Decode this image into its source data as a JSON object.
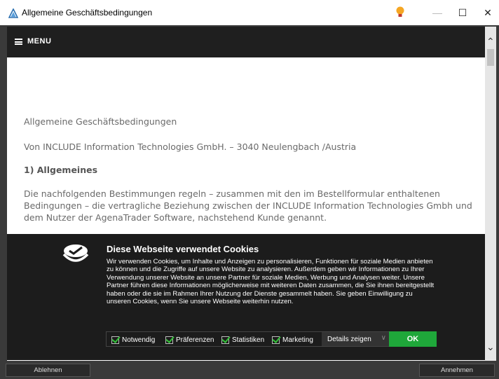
{
  "window": {
    "title": "Allgemeine Geschäftsbedingungen",
    "controls": {
      "minimize": "—",
      "maximize": "☐",
      "close": "✕"
    }
  },
  "menu": {
    "label": "MENU"
  },
  "page": {
    "paragraph1": "Allgemeine Geschäftsbedingungen",
    "paragraph2": "Von INCLUDE Information Technologies GmbH. – 3040 Neulengbach /Austria",
    "heading1": "1) Allgemeines",
    "paragraph3": "Die nachfolgenden Bestimmungen regeln – zusammen mit den im Bestellformular enthaltenen Bedingungen – die vertragliche Beziehung zwischen der INCLUDE Information Technologies Gmbh und dem Nutzer der AgenaTrader Software, nachstehend Kunde genannt."
  },
  "cookie_banner": {
    "title": "Diese Webseite verwendet Cookies",
    "text": "Wir verwenden Cookies, um Inhalte und Anzeigen zu personalisieren, Funktionen für soziale Medien anbieten zu können und die Zugriffe auf unsere Website zu analysieren. Außerdem geben wir Informationen zu Ihrer Verwendung unserer Website an unsere Partner für soziale Medien, Werbung und Analysen weiter. Unsere Partner führen diese Informationen möglicherweise mit weiteren Daten zusammen, die Sie ihnen bereitgestellt haben oder die sie im Rahmen Ihrer Nutzung der Dienste gesammelt haben. Sie geben Einwilligung zu unseren Cookies, wenn Sie unsere Webseite weiterhin nutzen.",
    "options": [
      {
        "label": "Notwendig",
        "checked": true
      },
      {
        "label": "Präferenzen",
        "checked": true
      },
      {
        "label": "Statistiken",
        "checked": true
      },
      {
        "label": "Marketing",
        "checked": true
      }
    ],
    "details_label": "Details zeigen",
    "ok_label": "OK"
  },
  "bottom": {
    "decline_label": "Ablehnen",
    "accept_label": "Annehmen"
  },
  "colors": {
    "accent_green": "#1fa73a",
    "banner_bg": "#1c1c1c",
    "frame_bg": "#3a3a3a"
  }
}
